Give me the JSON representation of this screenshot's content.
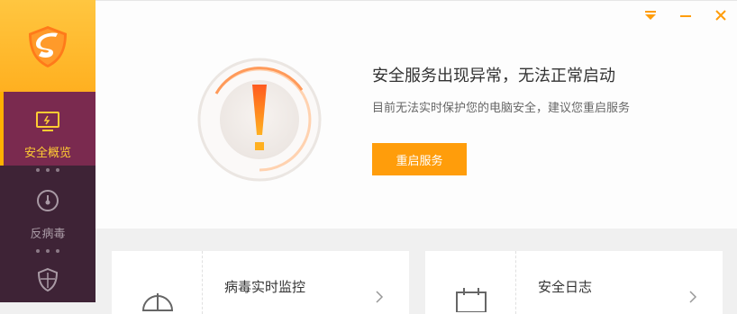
{
  "sidebar": {
    "logo_icon": "shield-logo-icon",
    "items": [
      {
        "label": "安全概览",
        "icon": "monitor-icon",
        "active": true
      },
      {
        "label": "反病毒",
        "icon": "gauge-icon",
        "active": false
      },
      {
        "label": "",
        "icon": "shield-icon",
        "active": false
      }
    ]
  },
  "window_controls": {
    "menu": "dropdown-arrow-icon",
    "minimize": "minimize-icon",
    "close": "close-icon"
  },
  "status": {
    "icon": "exclamation-warning-icon",
    "title": "安全服务出现异常，无法正常启动",
    "subtitle": "目前无法实时保护您的电脑安全，建议您重启服务",
    "button_label": "重启服务"
  },
  "cards": [
    {
      "label": "病毒实时监控",
      "icon": "umbrella-icon"
    },
    {
      "label": "安全日志",
      "icon": "calendar-icon"
    }
  ],
  "colors": {
    "accent": "#ff9d0b",
    "sidebar": "#3e2336",
    "active_nav": "#7a2a4f",
    "logo_bg": "#ffc640"
  }
}
